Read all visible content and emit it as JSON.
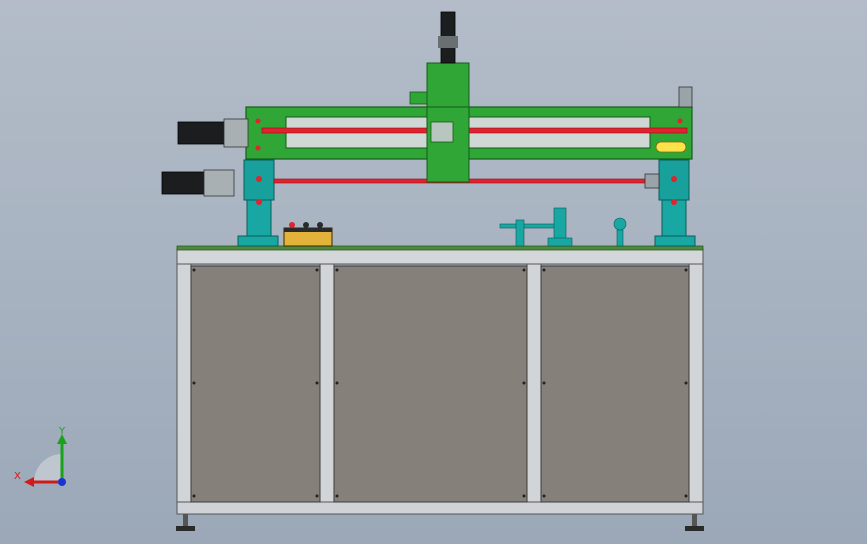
{
  "viewport": {
    "background_top": "#b3bcc8",
    "background_bottom": "#9ba8b8"
  },
  "colors": {
    "frame_green": "#2fa636",
    "frame_green_dark": "#1d7a22",
    "shaft_red": "#e0232d",
    "support_teal": "#19a7a3",
    "motor_black": "#1b1d1f",
    "cabinet_panel": "#86807b",
    "cabinet_frame": "#cfd2d6",
    "cabinet_frame_dark": "#8e9398",
    "table_top": "#4e8a3d",
    "control_box_yellow": "#e2b23a",
    "indicator_yellow": "#ffe14a"
  },
  "model": {
    "parts": [
      "top-servo-motor",
      "vertical-slide-carriage",
      "gantry-frame",
      "upper-lead-screw",
      "lower-lead-screw",
      "left-upper-motor",
      "left-lower-motor",
      "left-support-column",
      "right-support-column",
      "control-box",
      "fixture-assembly",
      "cabinet-base",
      "leveling-feet"
    ]
  },
  "triad": {
    "x_label": "X",
    "y_label": "Y",
    "x_color": "#d11a1a",
    "y_color": "#18a318",
    "z_color": "#1a33d1"
  }
}
